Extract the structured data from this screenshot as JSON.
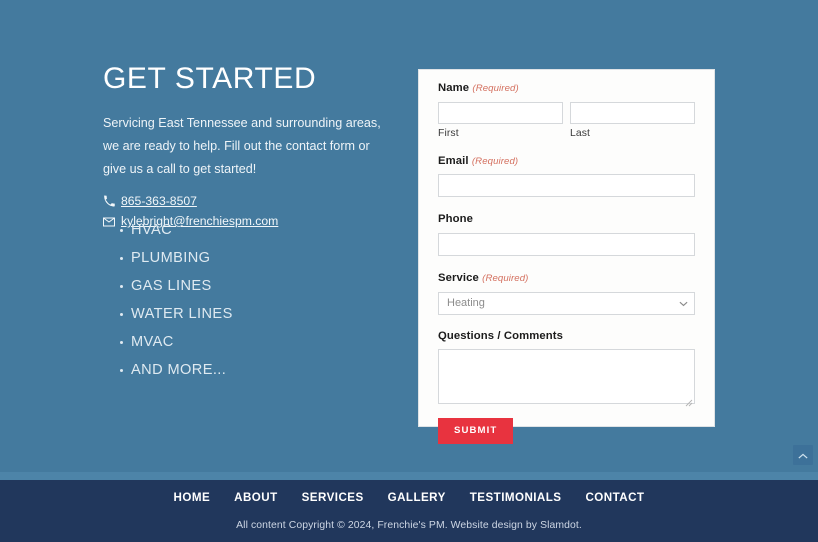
{
  "colors": {
    "page_background": "#447a9e",
    "footer_background": "#21375c",
    "footer_divider": "#4d84a8",
    "card_background": "#fdfdfc",
    "submit_button": "#e8333f",
    "required_marker": "#d4705f",
    "scroll_top_button": "#3d7199"
  },
  "contact": {
    "title": "GET STARTED",
    "intro": "Servicing East Tennessee and surrounding areas, we are ready to help. Fill out the contact form or give us a call to get started!",
    "phone": "865-363-8507",
    "phone_icon": "phone-icon",
    "email": "kylebright@frenchiespm.com",
    "email_icon": "envelope-icon",
    "services": [
      "HVAC",
      "PLUMBING",
      "GAS LINES",
      "WATER LINES",
      "MVAC",
      "AND MORE..."
    ]
  },
  "form": {
    "name": {
      "label": "Name",
      "required_text": "(Required)",
      "first_value": "",
      "first_sublabel": "First",
      "last_value": "",
      "last_sublabel": "Last"
    },
    "email": {
      "label": "Email",
      "required_text": "(Required)",
      "value": ""
    },
    "phone": {
      "label": "Phone",
      "value": ""
    },
    "service": {
      "label": "Service",
      "required_text": "(Required)",
      "selected": "Heating",
      "chevron_icon": "chevron-down-icon"
    },
    "questions": {
      "label": "Questions / Comments",
      "value": ""
    },
    "submit_label": "SUBMIT"
  },
  "scroll_top": {
    "icon": "chevron-up-icon"
  },
  "footer": {
    "nav": [
      "HOME",
      "ABOUT",
      "SERVICES",
      "GALLERY",
      "TESTIMONIALS",
      "CONTACT"
    ],
    "copyright": "All content Copyright © 2024, Frenchie's PM. Website design by Slamdot."
  }
}
